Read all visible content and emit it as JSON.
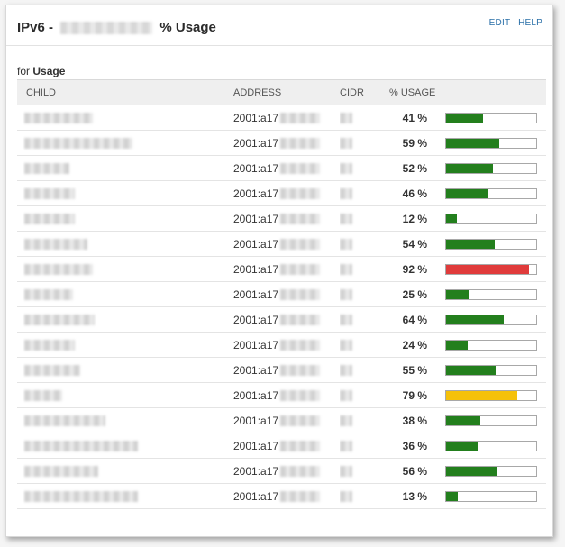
{
  "header": {
    "title_prefix": "IPv6 -",
    "title_suffix": "% Usage",
    "edit_label": "EDIT",
    "help_label": "HELP"
  },
  "subheader": {
    "for_text": "for",
    "for_bold": "Usage"
  },
  "table": {
    "columns": [
      "CHILD",
      "ADDRESS",
      "CIDR",
      "% USAGE",
      ""
    ],
    "rows": [
      {
        "address": "2001:a17",
        "usage": "41 %",
        "pct": 41,
        "color": "#237f1d"
      },
      {
        "address": "2001:a17",
        "usage": "59 %",
        "pct": 59,
        "color": "#237f1d"
      },
      {
        "address": "2001:a17",
        "usage": "52 %",
        "pct": 52,
        "color": "#237f1d"
      },
      {
        "address": "2001:a17",
        "usage": "46 %",
        "pct": 46,
        "color": "#237f1d"
      },
      {
        "address": "2001:a17",
        "usage": "12 %",
        "pct": 12,
        "color": "#237f1d"
      },
      {
        "address": "2001:a17",
        "usage": "54 %",
        "pct": 54,
        "color": "#237f1d"
      },
      {
        "address": "2001:a17",
        "usage": "92 %",
        "pct": 92,
        "color": "#e03b3b"
      },
      {
        "address": "2001:a17",
        "usage": "25 %",
        "pct": 25,
        "color": "#237f1d"
      },
      {
        "address": "2001:a17",
        "usage": "64 %",
        "pct": 64,
        "color": "#237f1d"
      },
      {
        "address": "2001:a17",
        "usage": "24 %",
        "pct": 24,
        "color": "#237f1d"
      },
      {
        "address": "2001:a17",
        "usage": "55 %",
        "pct": 55,
        "color": "#237f1d"
      },
      {
        "address": "2001:a17",
        "usage": "79 %",
        "pct": 79,
        "color": "#f5c10a"
      },
      {
        "address": "2001:a17",
        "usage": "38 %",
        "pct": 38,
        "color": "#237f1d"
      },
      {
        "address": "2001:a17",
        "usage": "36 %",
        "pct": 36,
        "color": "#237f1d"
      },
      {
        "address": "2001:a17",
        "usage": "56 %",
        "pct": 56,
        "color": "#237f1d"
      },
      {
        "address": "2001:a17",
        "usage": "13 %",
        "pct": 13,
        "color": "#237f1d"
      }
    ]
  }
}
